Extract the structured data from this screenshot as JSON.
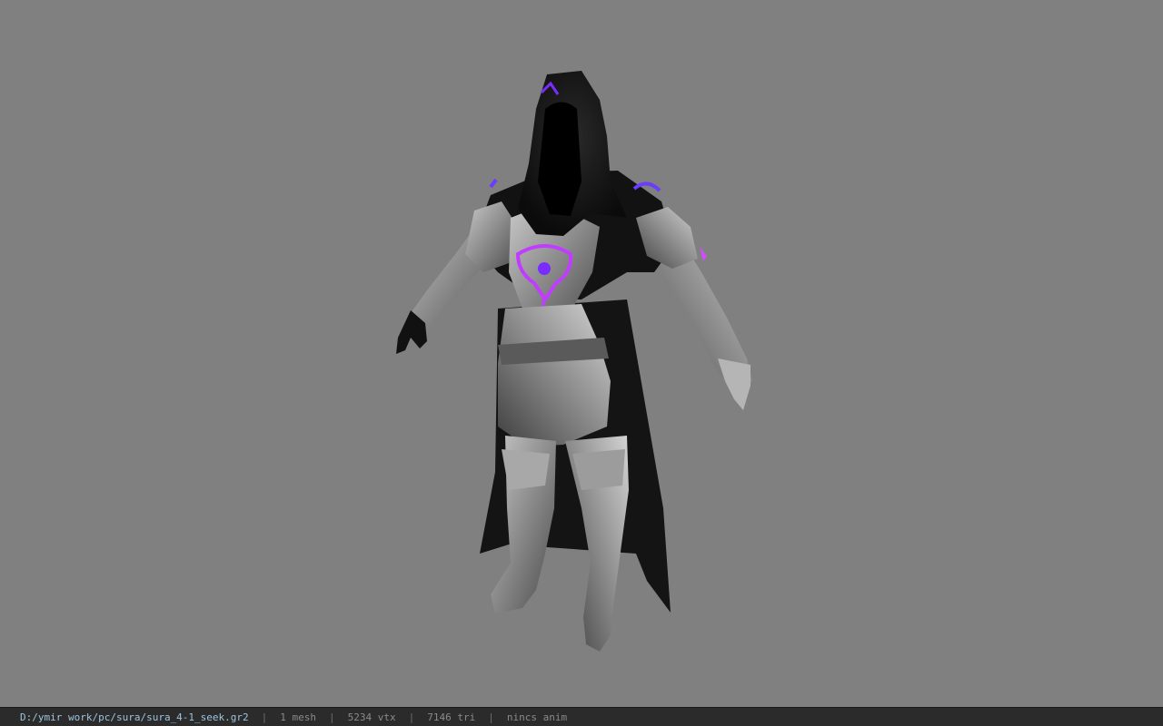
{
  "viewer": {
    "background_color": "#808080",
    "model_name": "sura_4-1_seek",
    "glow_colors": [
      "#7a2cff",
      "#d24cff"
    ]
  },
  "status_bar": {
    "file_path": "D:/ymir work/pc/sura/sura_4-1_seek.gr2",
    "mesh_info": "1 mesh",
    "vertex_info": "5234 vtx",
    "triangle_info": "7146 tri",
    "anim_info": "nincs anim",
    "separator": "|"
  }
}
